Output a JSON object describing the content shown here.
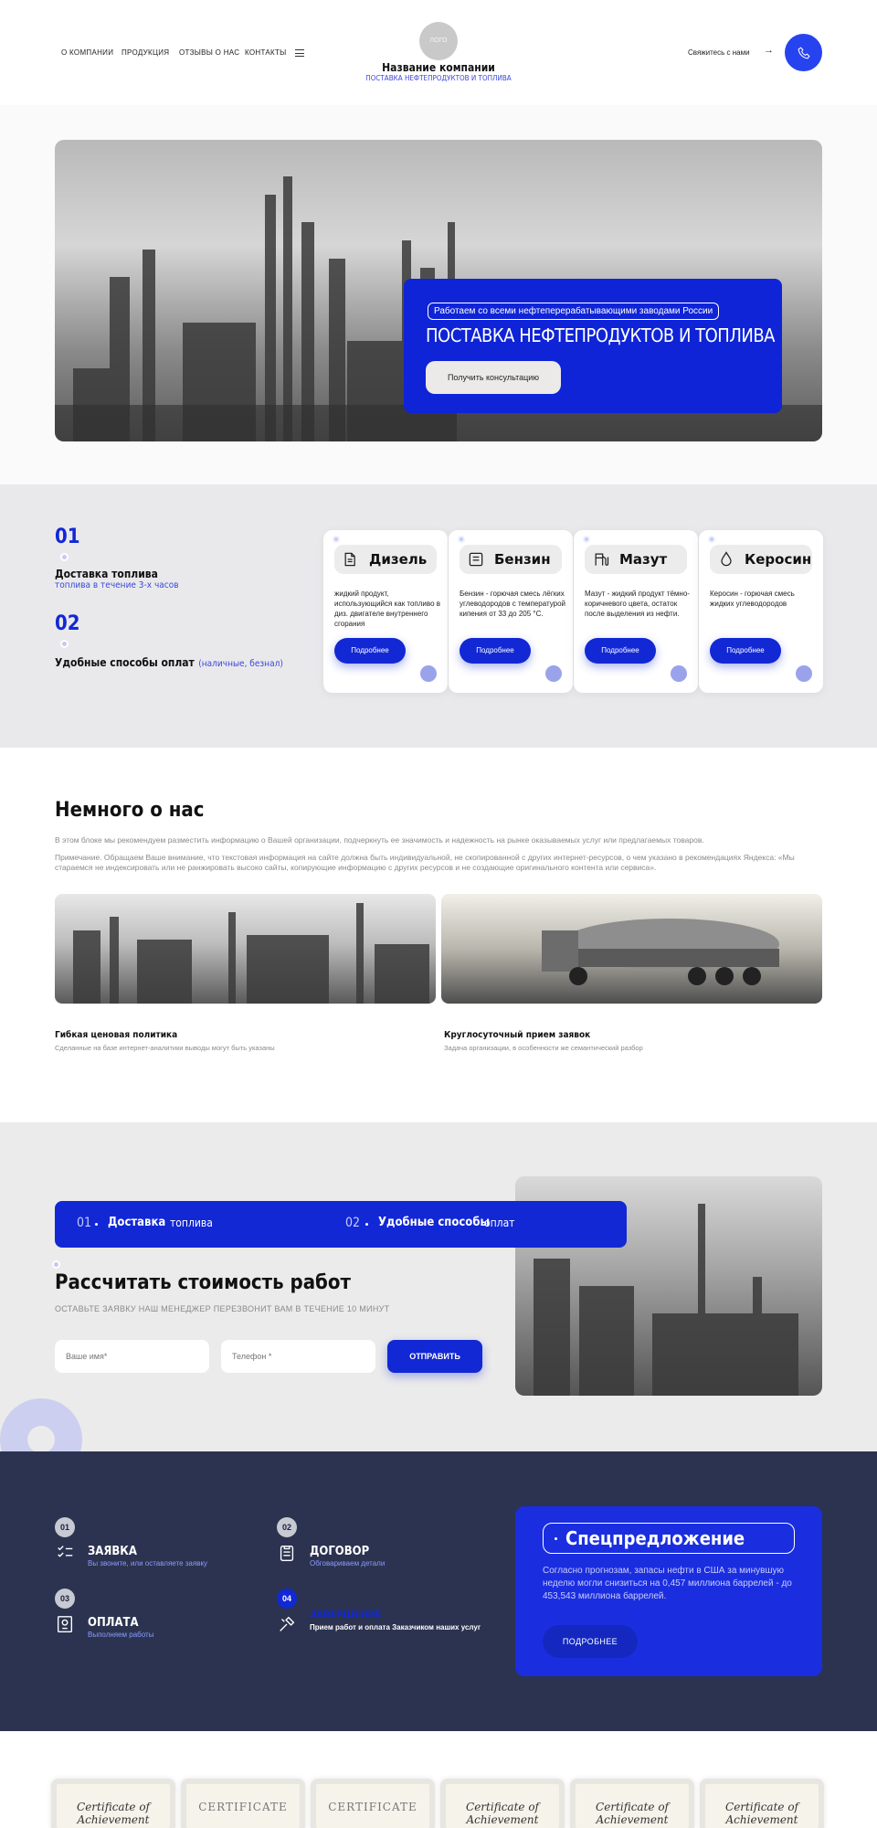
{
  "header": {
    "nav": [
      "О КОМПАНИИ",
      "ПРОДУКЦИЯ",
      "ОТЗЫВЫ О НАС",
      "КОНТАКТЫ"
    ],
    "logo_text": "ЛОГО",
    "company_name": "Название компании",
    "company_tagline": "ПОСТАВКА НЕФТЕПРОДУКТОВ И ТОПЛИВА",
    "contact_label": "Свяжитесь с нами"
  },
  "hero": {
    "badge": "Работаем со всеми нефтеперерабатывающими заводами России",
    "title": "ПОСТАВКА НЕФТЕПРОДУКТОВ И ТОПЛИВА",
    "button": "Получить консультацию"
  },
  "benefits": {
    "items": [
      {
        "num": "01",
        "title": "Доставка топлива",
        "sub": "топлива в течение 3-х часов"
      },
      {
        "num": "02",
        "title": "Удобные способы оплат",
        "sub": "(наличные, безнал)"
      }
    ],
    "products": [
      {
        "title": "Дизель",
        "desc": "жидкий продукт, использующийся как топливо в диз. двигателе внутреннего сгорания",
        "button": "Подробнее",
        "icon": "fuel-canister-icon"
      },
      {
        "title": "Бензин",
        "desc": "Бензин - горючая смесь лёгких углеводородов с температурой кипения от 33 до 205 °C.",
        "button": "Подробнее",
        "icon": "fuel-tank-icon"
      },
      {
        "title": "Мазут",
        "desc": "Мазут - жидкий продукт тёмно-коричневого цвета, остаток после выделения из нефти.",
        "button": "Подробнее",
        "icon": "gas-station-icon"
      },
      {
        "title": "Керосин",
        "desc": "Керосин - горючая смесь жидких углеводородов",
        "button": "Подробнее",
        "icon": "oil-drop-icon"
      }
    ]
  },
  "about": {
    "title": "Немного о нас",
    "p1": "В этом блоке мы рекомендуем разместить информацию о Вашей организации, подчеркнуть ее значимость и надежность на рынке оказываемых услуг или предлагаемых товаров.",
    "p2": "Примечание. Обращаем Ваше внимание, что текстовая информация на сайте должна быть индивидуальной, не скопированной с других интернет-ресурсов, о чем указано в рекомендациях Яндекса: «Мы стараемся не индексировать или не ранжировать высоко сайты, копирующие информацию с других ресурсов и не создающие оригинального контента или сервиса».",
    "features": [
      {
        "title": "Гибкая ценовая политика",
        "sub": "Сделанные на базе интернет-аналитики выводы могут быть указаны"
      },
      {
        "title": "Круглосуточный прием заявок",
        "sub": "Задача организации, в особенности же семантический разбор"
      }
    ]
  },
  "calc": {
    "strip": [
      {
        "num": "01",
        "bold": "Доставка",
        "rest": "топлива"
      },
      {
        "num": "02",
        "bold": "Удобные способы",
        "rest": "оплат"
      }
    ],
    "title": "Рассчитать стоимость работ",
    "subtitle": "ОСТАВЬТЕ ЗАЯВКУ НАШ МЕНЕДЖЕР ПЕРЕЗВОНИТ ВАМ В ТЕЧЕНИЕ 10 МИНУТ",
    "name_placeholder": "Ваше имя*",
    "phone_placeholder": "Телефон *",
    "submit": "ОТПРАВИТЬ"
  },
  "steps": {
    "items": [
      {
        "num": "01",
        "title": "ЗАЯВКА",
        "sub": "Вы звоните, или оставляете заявку",
        "icon": "checklist-icon"
      },
      {
        "num": "02",
        "title": "ДОГОВОР",
        "sub": "Обговариваем детали",
        "icon": "clipboard-icon"
      },
      {
        "num": "03",
        "title": "ОПЛАТА",
        "sub": "Выполняем работы",
        "icon": "certificate-icon"
      },
      {
        "num": "04",
        "title": "ЗАВЕРШЕНИЕ",
        "sub": "Прием работ и оплата Заказчиком наших услуг",
        "icon": "tools-icon"
      }
    ],
    "special_title": "Спецпредложение",
    "special_text": "Согласно прогнозам, запасы нефти в США за минувшую неделю могли снизиться на 0,457 миллиона баррелей - до 453,543 миллиона баррелей.",
    "special_button": "ПОДРОБНЕЕ"
  },
  "certificates": [
    "Certificate of Achievement",
    "CERTIFICATE",
    "CERTIFICATE",
    "Certificate of Achievement",
    "Certificate of Achievement",
    "Certificate of Achievement"
  ],
  "colors": {
    "accent": "#1228d4",
    "dark": "#2b3350",
    "light_bg": "#e9e9ec"
  }
}
